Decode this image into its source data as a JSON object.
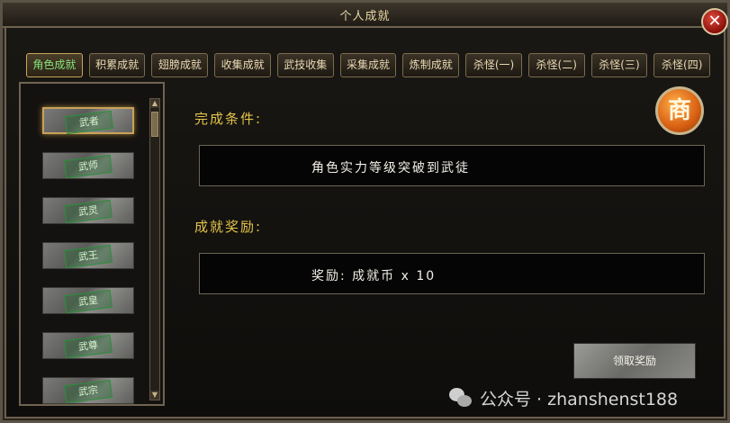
{
  "window": {
    "title": "个人成就"
  },
  "tabs": [
    {
      "label": "角色成就",
      "active": true
    },
    {
      "label": "积累成就",
      "active": false
    },
    {
      "label": "翅膀成就",
      "active": false
    },
    {
      "label": "收集成就",
      "active": false
    },
    {
      "label": "武技收集",
      "active": false
    },
    {
      "label": "采集成就",
      "active": false
    },
    {
      "label": "炼制成就",
      "active": false
    },
    {
      "label": "杀怪(一)",
      "active": false
    },
    {
      "label": "杀怪(二)",
      "active": false
    },
    {
      "label": "杀怪(三)",
      "active": false
    },
    {
      "label": "杀怪(四)",
      "active": false
    }
  ],
  "achievements": [
    {
      "label": "武者",
      "selected": true
    },
    {
      "label": "武师",
      "selected": false
    },
    {
      "label": "武灵",
      "selected": false
    },
    {
      "label": "武王",
      "selected": false
    },
    {
      "label": "武皇",
      "selected": false
    },
    {
      "label": "武尊",
      "selected": false
    },
    {
      "label": "武宗",
      "selected": false
    }
  ],
  "detail": {
    "condition_title": "完成条件:",
    "condition_text": "角色实力等级突破到武徒",
    "reward_title": "成就奖励:",
    "reward_text": "奖励: 成就币 x 10",
    "claim_label": "领取奖励",
    "shop_label": "商"
  },
  "watermark": {
    "text": "公众号 · zhanshenst188"
  },
  "icons": {
    "close": "close-icon",
    "shop": "shop-icon",
    "wechat": "wechat-icon"
  },
  "colors": {
    "gold": "#e4c44a",
    "active_tab": "#86e47a",
    "stamp_green": "#2d8f3c"
  }
}
